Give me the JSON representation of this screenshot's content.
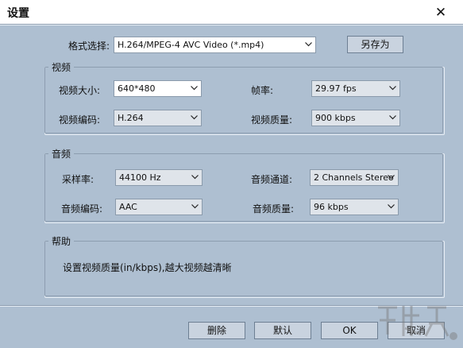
{
  "window": {
    "title": "设置"
  },
  "format": {
    "label": "格式选择:",
    "value": "H.264/MPEG-4 AVC Video (*.mp4)",
    "save_as": "另存为"
  },
  "video": {
    "legend": "视频",
    "size_label": "视频大小:",
    "size_value": "640*480",
    "fps_label": "帧率:",
    "fps_value": "29.97 fps",
    "codec_label": "视频编码:",
    "codec_value": "H.264",
    "quality_label": "视频质量:",
    "quality_value": "900 kbps"
  },
  "audio": {
    "legend": "音频",
    "rate_label": "采样率:",
    "rate_value": "44100 Hz",
    "channels_label": "音频通道:",
    "channels_value": "2 Channels Stereo",
    "codec_label": "音频编码:",
    "codec_value": "AAC",
    "quality_label": "音频质量:",
    "quality_value": "96 kbps"
  },
  "help": {
    "legend": "帮助",
    "text": "设置视频质量(in/kbps),越大视频越清晰"
  },
  "buttons": {
    "delete": "删除",
    "default": "默认",
    "ok": "OK",
    "cancel": "取消"
  },
  "colors": {
    "dialog_bg": "#aebfd1",
    "button_bg": "#c9d3df",
    "combo_bg": "#dfe4ea"
  }
}
